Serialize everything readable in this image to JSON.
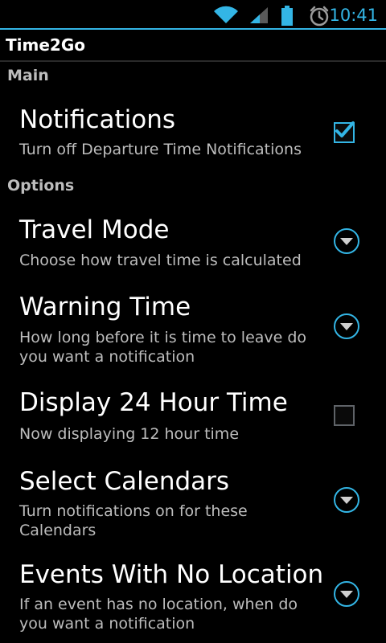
{
  "status_bar": {
    "time": "10:41",
    "icons": [
      "wifi-icon",
      "signal-icon",
      "battery-icon",
      "alarm-icon"
    ]
  },
  "app": {
    "title": "Time2Go"
  },
  "sections": {
    "main": "Main",
    "options": "Options"
  },
  "prefs": {
    "notifications": {
      "title": "Notifications",
      "summary": "Turn off Departure Time Notifications",
      "checked": true
    },
    "travel_mode": {
      "title": "Travel Mode",
      "summary": "Choose how travel time is calculated"
    },
    "warning_time": {
      "title": "Warning Time",
      "summary": "How long before it is time to leave do you want a notification"
    },
    "display_24": {
      "title": "Display 24 Hour Time",
      "summary": "Now displaying 12 hour time",
      "checked": false
    },
    "select_calendars": {
      "title": "Select Calendars",
      "summary": "Turn notifications on for these Calendars"
    },
    "no_location": {
      "title": "Events With No Location",
      "summary": "If an event has no location, when do you want a notification"
    }
  },
  "colors": {
    "accent": "#33b5e5",
    "background": "#000000",
    "summary_text": "#bdbdbd"
  }
}
